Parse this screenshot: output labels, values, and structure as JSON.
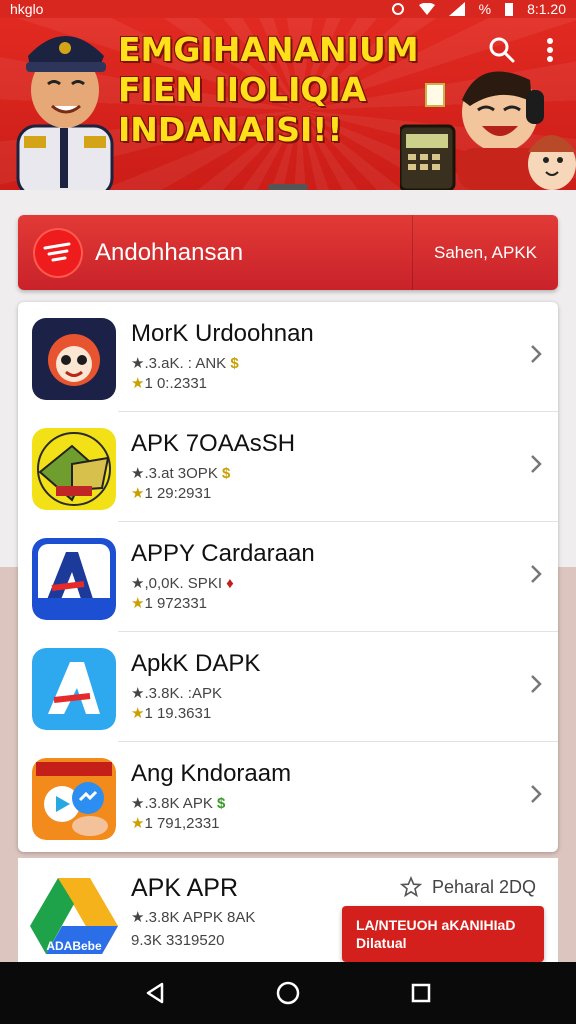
{
  "status_bar": {
    "left_text": "hkglo",
    "battery": "%",
    "time": "8:1.20",
    "colors": {
      "background": "#d8271f"
    }
  },
  "banner": {
    "title_lines": [
      "EMGIHANANIUM",
      "FIEN IIOLIQIA",
      "INDANAISI!!"
    ],
    "icons": [
      "search-icon",
      "more-vert-icon"
    ],
    "colors": {
      "background": "#e32b22",
      "title": "#ffe01a"
    }
  },
  "download_bar": {
    "title": "Andohhansan",
    "action": "Sahen, APKK",
    "colors": {
      "background": "#d8262a"
    }
  },
  "apps": [
    {
      "name": "MorK Urdoohnan",
      "meta1": "★.3.aK. : ANK",
      "meta2": "1 0:.2331",
      "icon": "mascot-app-icon"
    },
    {
      "name": "APK 7OAAsSH",
      "meta1": "★.3.at  3OPK",
      "meta2": "1 29:2931",
      "icon": "map-app-icon"
    },
    {
      "name": "APPY Cardaraan",
      "meta1": "★,0,0K.  SPKI",
      "meta2": "1 972331",
      "icon": "letter-a-app-icon"
    },
    {
      "name": "ApkK DAPK",
      "meta1": "★.3.8K.  :APK",
      "meta2": "1 19.3631",
      "icon": "letter-a-blue-app-icon"
    },
    {
      "name": "Ang Kndoraam",
      "meta1": "★.3.8K   APK",
      "meta2": "1 791,2331",
      "icon": "messenger-app-icon"
    }
  ],
  "last_app": {
    "name": "APK APR",
    "meta1": "★.3.8K  APPK    8AK",
    "meta2": "9.3K  3319520",
    "right_text": "Peharal 2DQ",
    "icon_label": "ADABebe",
    "icon": "drive-app-icon"
  },
  "popup": {
    "line1": "LA/NTEUOH aKANIHIaD",
    "line2": "Dilatual"
  },
  "nav": {
    "icons": [
      "back-icon",
      "home-icon",
      "recents-icon"
    ]
  }
}
